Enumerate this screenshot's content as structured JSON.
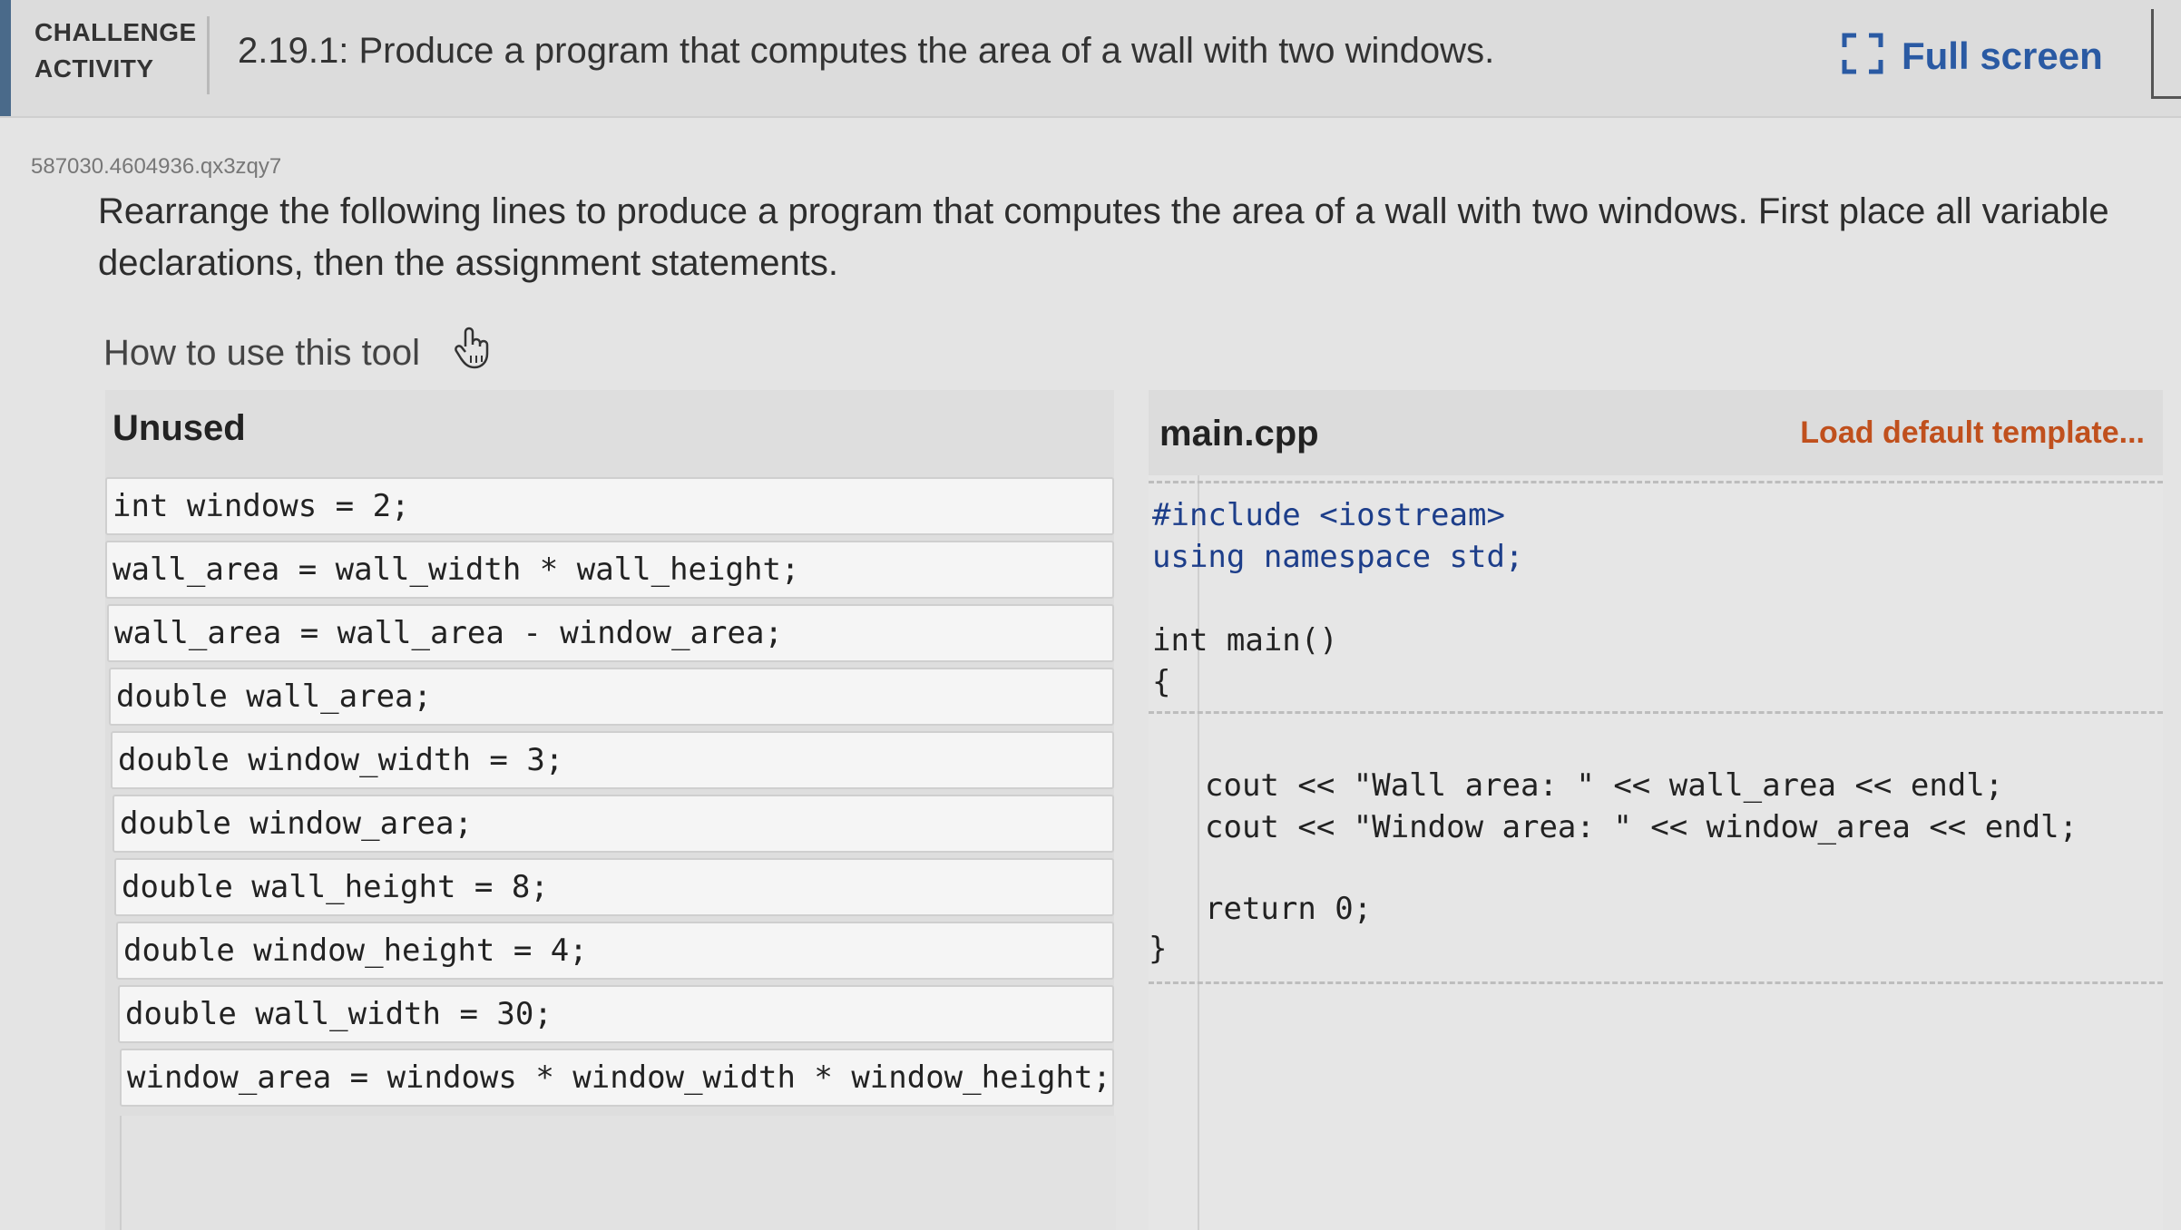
{
  "header": {
    "label_line1": "CHALLENGE",
    "label_line2": "ACTIVITY",
    "title": "2.19.1: Produce a program that computes the area of a wall with two windows.",
    "fullscreen_label": "Full screen"
  },
  "activity_id": "587030.4604936.qx3zqy7",
  "instructions": "Rearrange the following lines to produce a program that computes the area of a wall with two windows. First place all variable declarations, then the assignment statements.",
  "howto_label": "How to use this tool",
  "unused": {
    "title": "Unused",
    "tiles": [
      "int windows = 2;",
      "wall_area = wall_width * wall_height;",
      "wall_area = wall_area - window_area;",
      "double wall_area;",
      "double window_width = 3;",
      "double window_area;",
      "double wall_height = 8;",
      "double window_height = 4;",
      "double wall_width = 30;",
      "window_area = windows * window_width * window_height;"
    ]
  },
  "editor": {
    "filename": "main.cpp",
    "load_template_label": "Load default template...",
    "header_lines": {
      "include": "#include <iostream>",
      "using": "using namespace std;",
      "main_sig": "int main()",
      "open_brace": "{"
    },
    "body_lines": {
      "cout_wall": "cout << \"Wall area: \" << wall_area << endl;",
      "cout_window": "cout << \"Window area: \" << window_area << endl;",
      "return_stmt": "return 0;",
      "close_brace": "}"
    }
  },
  "colors": {
    "link_blue": "#2a5aa3",
    "template_orange": "#c0501d",
    "code_keyword": "#1d3e8a"
  }
}
